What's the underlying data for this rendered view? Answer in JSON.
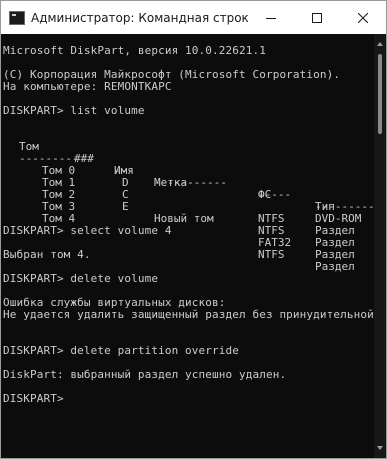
{
  "window": {
    "title": "Администратор: Командная строка -..."
  },
  "console": {
    "line1": "Microsoft DiskPart, версия 10.0.22621.1",
    "line2": "(C) Корпорация Майкрософт (Microsoft Corporation).",
    "line3": "На компьютере: REMONTKAPC",
    "cmd1": "DISKPART> list volume",
    "table": {
      "headers": [
        "Том",
        "###",
        "Имя",
        "Метка",
        "ФС",
        "Тип"
      ],
      "separators": [
        "---------",
        "---",
        "-----------",
        "-----",
        "----------"
      ],
      "rows": [
        [
          "Том 0",
          "D",
          "",
          "",
          "DVD-ROM"
        ],
        [
          "Том 1",
          "C",
          "",
          "NTFS",
          "Раздел"
        ],
        [
          "Том 2",
          "E",
          "Новый том",
          "NTFS",
          "Раздел"
        ],
        [
          "Том 3",
          "",
          "",
          "FAT32",
          "Раздел"
        ],
        [
          "Том 4",
          "",
          "",
          "NTFS",
          "Раздел"
        ]
      ]
    },
    "cmd2": "DISKPART> select volume 4",
    "out2": "Выбран том 4.",
    "cmd3": "DISKPART> delete volume",
    "err1": "Ошибка службы виртуальных дисков:",
    "err2": "Не удается удалить защищенный раздел без принудительной установки защищенных параметров.",
    "cmd4": "DISKPART> delete partition override",
    "out4": "DiskPart: выбранный раздел успешно удален.",
    "prompt": "DISKPART>"
  }
}
